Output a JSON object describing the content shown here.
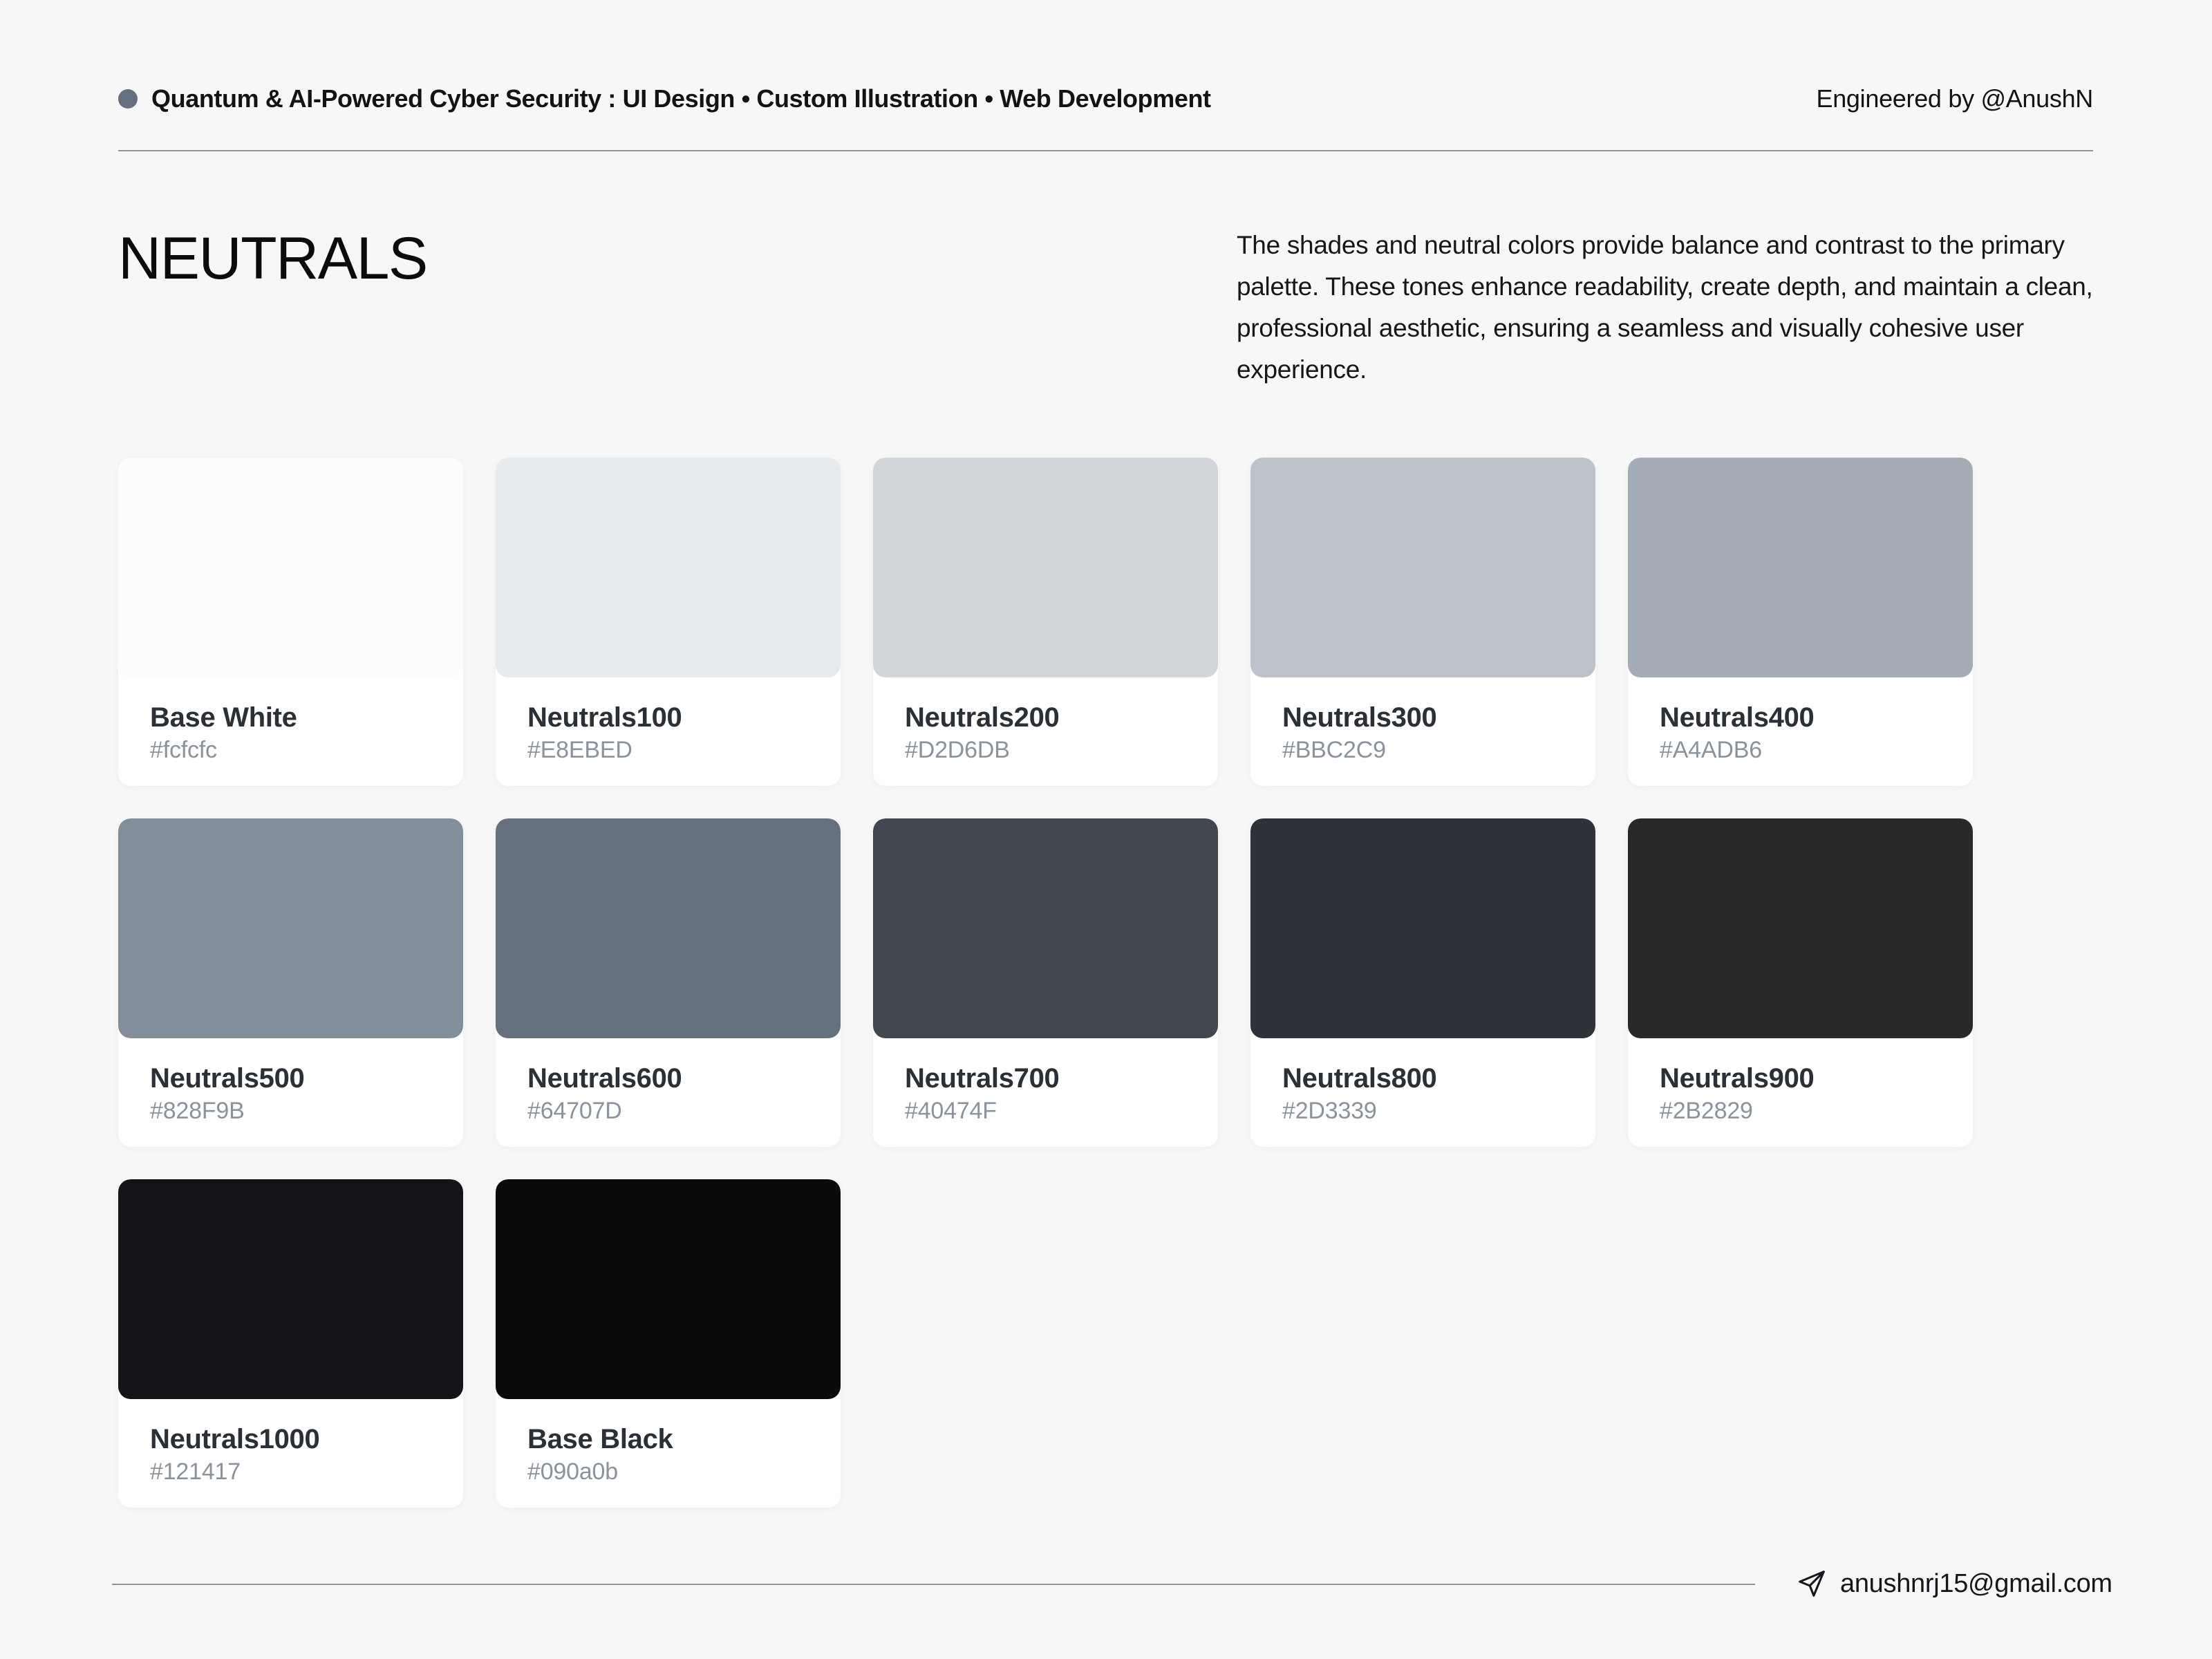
{
  "header": {
    "project_title": "Quantum & AI-Powered Cyber Security : UI Design • Custom Illustration • Web Development",
    "credit": "Engineered by @AnushN",
    "dot_color": "#64707d"
  },
  "section": {
    "title": "NEUTRALS",
    "description": "The shades and neutral colors provide balance and contrast to the primary palette. These tones enhance readability, create depth, and maintain a clean, professional aesthetic, ensuring a seamless and visually cohesive user experience."
  },
  "swatches": [
    {
      "name": "Base White",
      "hex": "#fcfcfc"
    },
    {
      "name": "Neutrals100",
      "hex": "#E8EBED"
    },
    {
      "name": "Neutrals200",
      "hex": "#D2D6DB"
    },
    {
      "name": "Neutrals300",
      "hex": "#BBC2C9"
    },
    {
      "name": "Neutrals400",
      "hex": "#A4ADB6"
    },
    {
      "name": "Neutrals500",
      "hex": "#828F9B"
    },
    {
      "name": "Neutrals600",
      "hex": "#64707D"
    },
    {
      "name": "Neutrals700",
      "hex": "#40474F"
    },
    {
      "name": "Neutrals800",
      "hex": "#2D3339"
    },
    {
      "name": "Neutrals900",
      "hex": "#2B2829"
    },
    {
      "name": "Neutrals1000",
      "hex": "#121417"
    },
    {
      "name": "Base Black",
      "hex": "#090a0b"
    }
  ],
  "footer": {
    "email": "anushnrj15@gmail.com",
    "icon": "send-icon"
  }
}
